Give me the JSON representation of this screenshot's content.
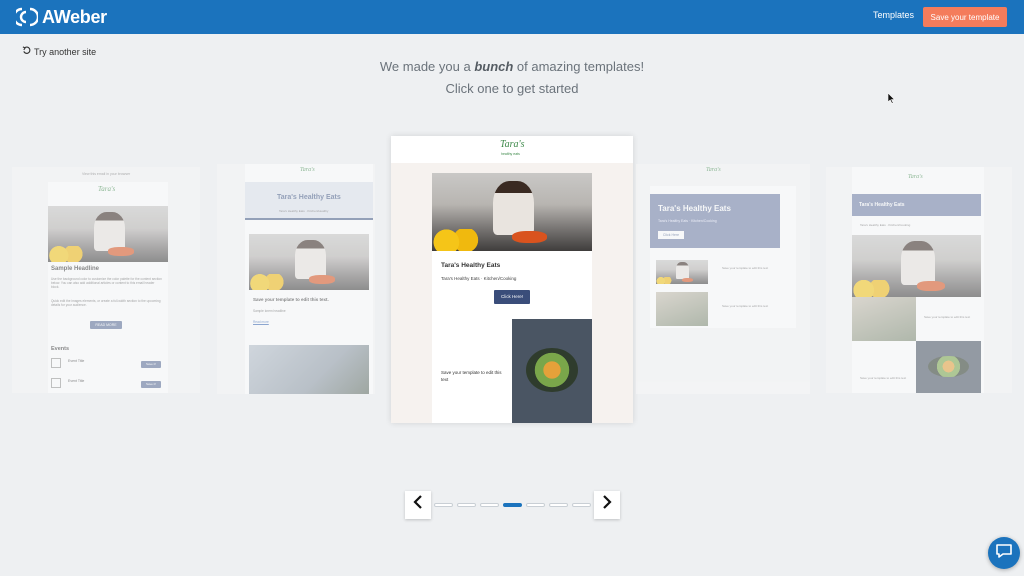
{
  "header": {
    "logo_text": "AWeber",
    "nav_templates": "Templates",
    "save_template": "Save your template",
    "colors": {
      "bar": "#1b73bd",
      "save_button": "#f47c5c"
    }
  },
  "try_another": {
    "icon": "undo-icon",
    "label": "Try another site"
  },
  "heading": {
    "line1_before": "We made you a ",
    "line1_emphasis": "bunch",
    "line1_after": " of amazing templates!",
    "line2": "Click one to get started"
  },
  "templates": {
    "card1": {
      "top_note": "View this email in your browser",
      "brand": "Tara's",
      "headline": "Sample Headline",
      "body1": "Use the background color to customize the color palette for the content section below. You can also add additional articles or content to this email header block.",
      "body2": "Quick edit the images elements, or create a full-width section to the upcoming details for your audience.",
      "button": "READ MORE",
      "events_title": "Events",
      "event1": "Event Title",
      "event2": "Event Title",
      "event_button": "Save it!"
    },
    "card2": {
      "brand": "Tara's",
      "title": "Tara's Healthy Eats",
      "subtitle": "Tara's Healthy Eats · Kitchen/Healthy",
      "save_text": "Save your template to edit this text.",
      "body": "Sample lorem headline",
      "link": "Read more"
    },
    "card3": {
      "brand": "Tara's",
      "brand_sub": "healthy eats",
      "title": "Tara's Healthy Eats",
      "subtitle": "Tara's Healthy Eats · Kitchen/Cooking",
      "button": "Click Here!",
      "save_text": "Save your template to edit this text"
    },
    "card4": {
      "brand": "Tara's",
      "title": "Tara's Healthy Eats",
      "subtitle": "Tara's Healthy Eats · Kitchen/Cooking",
      "button": "Click Here",
      "row1": "Save your template to edit this text",
      "row2": "Save your template to edit this text"
    },
    "card5": {
      "brand": "Tara's",
      "title": "Tara's Healthy Eats",
      "subtitle": "Tara's Healthy Eats · Kitchen/Cooking",
      "text1": "Save your template to edit this text",
      "text2": "Save your template to edit this text"
    }
  },
  "pager": {
    "prev_icon": "chevron-left-icon",
    "next_icon": "chevron-right-icon",
    "dot_count": 7,
    "active_dot": 4
  },
  "chat": {
    "icon": "chat-bubble-icon"
  }
}
